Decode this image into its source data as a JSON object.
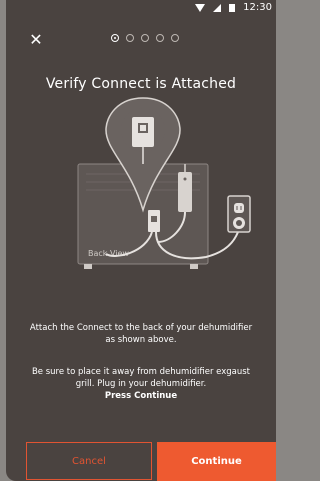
{
  "status_bar": {
    "time": "12:30"
  },
  "header": {
    "close_icon": "close-icon",
    "steps_total": 5,
    "current_step": 1
  },
  "title": "Verify Connect is Attached",
  "illustration": {
    "label": "Back View"
  },
  "instructions": {
    "line1": "Attach the Connect to the back of your dehumidifier as shown above.",
    "line2": "Be sure to place it away from dehumidifier exgaust grill. Plug in your dehumidifier.",
    "line3": "Press Continue"
  },
  "buttons": {
    "cancel": "Cancel",
    "continue": "Continue"
  },
  "colors": {
    "background": "#4a4340",
    "accent": "#ee5a30",
    "text": "#ffffff"
  }
}
